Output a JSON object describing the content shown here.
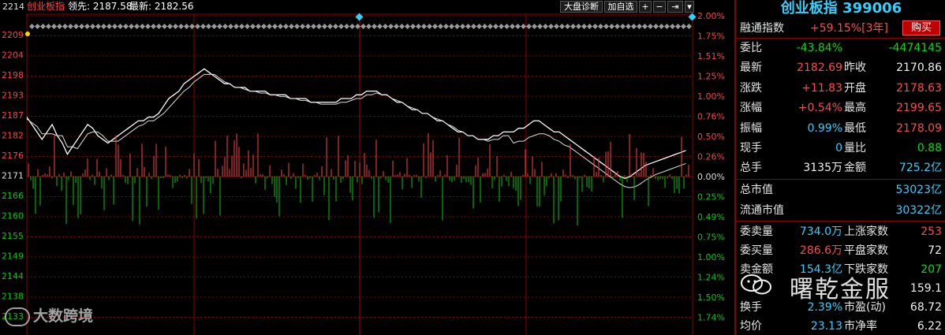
{
  "topbar": {
    "index_name": "创业板指",
    "lead_label": "领先: 2187.58",
    "last_label": "最新: 2182.56",
    "first_price": "2214",
    "buttons": [
      {
        "name": "market-diagnosis-button",
        "label": "大盘诊断"
      },
      {
        "name": "add-watchlist-button",
        "label": "加自选"
      },
      {
        "name": "zoom-in-button",
        "label": "+"
      },
      {
        "name": "zoom-out-button",
        "label": "−"
      },
      {
        "name": "move-right-button",
        "label": "⇥"
      },
      {
        "name": "dropdown-button",
        "label": "▾"
      }
    ]
  },
  "axis": {
    "left": [
      "2209",
      "2204",
      "2198",
      "2193",
      "2187",
      "2182",
      "2176",
      "2171",
      "2166",
      "2160",
      "2155",
      "2149",
      "2144",
      "2138",
      "2133"
    ],
    "right": [
      "2.00%",
      "1.75%",
      "1.51%",
      "1.25%",
      "1.00%",
      "0.76%",
      "0.50%",
      "0.26%",
      "0.00%",
      "0.25%",
      "0.49%",
      "0.75%",
      "1.00%",
      "1.24%",
      "1.50%",
      "1.74%"
    ]
  },
  "chart_data": {
    "type": "line",
    "title": "",
    "base_price": 2170.86,
    "ylim": [
      2128.3,
      2214.3
    ],
    "x_count": 240,
    "series": [
      {
        "values": [
          2187,
          2185,
          2183,
          2181,
          2183,
          2185,
          2182,
          2180,
          2177,
          2179,
          2181,
          2183,
          2185,
          2184,
          2182,
          2181,
          2180,
          2181,
          2182,
          2183,
          2184,
          2185,
          2186,
          2186,
          2187,
          2187,
          2188,
          2190,
          2192,
          2193,
          2194,
          2196,
          2197,
          2198,
          2199,
          2200,
          2199,
          2198,
          2197,
          2196,
          2196,
          2195,
          2195,
          2195,
          2194,
          2194,
          2194,
          2194,
          2193,
          2193,
          2193,
          2193,
          2192,
          2192,
          2192,
          2192,
          2191,
          2191,
          2191,
          2191,
          2191,
          2191,
          2192,
          2192,
          2192,
          2193,
          2193,
          2194,
          2194,
          2194,
          2193,
          2193,
          2192,
          2191,
          2191,
          2190,
          2189,
          2189,
          2188,
          2188,
          2187,
          2186,
          2186,
          2185,
          2184,
          2183,
          2183,
          2182,
          2182,
          2181,
          2181,
          2181,
          2182,
          2182,
          2183,
          2183,
          2183,
          2184,
          2184,
          2185,
          2186,
          2186,
          2185,
          2184,
          2183,
          2183,
          2182,
          2181,
          2180,
          2179,
          2178,
          2177,
          2176,
          2175,
          2174,
          2173,
          2172,
          2171,
          2170.5,
          2171,
          2172,
          2173,
          2174,
          2174.5,
          2175,
          2175.5,
          2176,
          2176.5,
          2177,
          2177.5,
          2178
        ]
      }
    ],
    "note": ""
  },
  "info": {
    "title": "创业板指 399006",
    "rongtong_label": "融通指数",
    "rongtong_value": "+59.15%[3年]",
    "buy_label": "购买",
    "rows_top": [
      {
        "l1": "委比",
        "v1": "-43.84%",
        "c1": "green",
        "l2": "",
        "v2": "-4474145",
        "c2": "green"
      },
      {
        "l1": "最新",
        "v1": "2182.69",
        "c1": "red",
        "l2": "昨收",
        "v2": "2170.86",
        "c2": "white"
      },
      {
        "l1": "涨跌",
        "v1": "+11.83",
        "c1": "red",
        "l2": "开盘",
        "v2": "2178.63",
        "c2": "red"
      },
      {
        "l1": "涨幅",
        "v1": "+0.54%",
        "c1": "red",
        "l2": "最高",
        "v2": "2199.65",
        "c2": "red"
      },
      {
        "l1": "振幅",
        "v1": "0.99%",
        "c1": "cyan",
        "l2": "最低",
        "v2": "2178.09",
        "c2": "red"
      },
      {
        "l1": "现手",
        "v1": "0",
        "c1": "cyan",
        "l2": "量比",
        "v2": "0.88",
        "c2": "green"
      },
      {
        "l1": "总手",
        "v1": "3135万",
        "c1": "white",
        "l2": "金额",
        "v2": "725.2亿",
        "c2": "cyan"
      }
    ],
    "market_cap_label": "总市值",
    "market_cap_value": "53023亿",
    "float_cap_label": "流通市值",
    "float_cap_value": "30322亿",
    "rows_bottom": [
      {
        "l1": "委卖量",
        "v1": "734.0万",
        "c1": "cyan",
        "l2": "上涨家数",
        "v2": "253",
        "c2": "red"
      },
      {
        "l1": "委买量",
        "v1": "286.6万",
        "c1": "red",
        "l2": "平盘家数",
        "v2": "72",
        "c2": "white"
      },
      {
        "l1": "卖金额",
        "v1": "154.3亿",
        "c1": "cyan",
        "l2": "下跌家数",
        "v2": "207",
        "c2": "green"
      },
      {
        "l1": "",
        "v1": "",
        "c1": "cyan",
        "l2": "",
        "v2": "159.1",
        "c2": "white"
      },
      {
        "l1": "换手",
        "v1": "2.39%",
        "c1": "cyan",
        "l2": "市盈(动)",
        "v2": "68.72",
        "c2": "white"
      },
      {
        "l1": "均价",
        "v1": "23.13",
        "c1": "cyan",
        "l2": "市净率",
        "v2": "6.22",
        "c2": "white"
      }
    ]
  },
  "watermark_left": "大数跨境",
  "watermark_right": "曙乾金服",
  "colors": {
    "grid": "#8b0000",
    "up": "#ff4040",
    "down": "#00cc00",
    "accent": "#2fd2ff"
  }
}
